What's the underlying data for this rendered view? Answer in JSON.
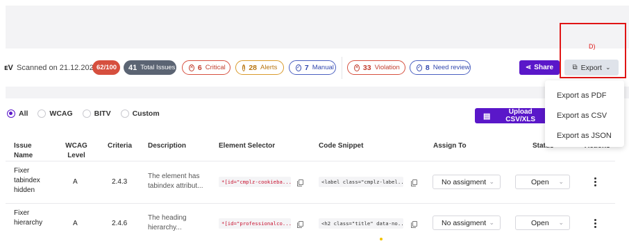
{
  "toolbar": {
    "title_fragment": "ᴇV",
    "scanned_label": "Scanned on 21.12.2025",
    "score": "62/100",
    "total_count": "41",
    "total_label": "Total Issues",
    "critical_count": "6",
    "critical_label": "Critical",
    "alerts_count": "28",
    "alerts_label": "Alerts",
    "manual_count": "7",
    "manual_label": "Manual",
    "violation_count": "33",
    "violation_label": "Violation",
    "review_count": "8",
    "review_label": "Need review",
    "share_label": "Share",
    "export_label": "Export",
    "annotation_label": "D)"
  },
  "filters": {
    "options": [
      "All",
      "WCAG",
      "BITV",
      "Custom"
    ],
    "selected": "All",
    "upload_label": "Upload CSV/XLS"
  },
  "export_menu": {
    "items": [
      "Export as PDF",
      "Export as CSV",
      "Export as JSON"
    ]
  },
  "table": {
    "headers": {
      "issue_name": [
        "Issue",
        "Name"
      ],
      "wcag_level": [
        "WCAG",
        "Level"
      ],
      "criteria": "Criteria",
      "description": "Description",
      "element_selector": "Element Selector",
      "code_snippet": "Code Snippet",
      "assign_to": "Assign To",
      "status": "Status",
      "actions": "Actions"
    },
    "rows": [
      {
        "name_lines": [
          "Fixer",
          "tabindex",
          "hidden"
        ],
        "level": "A",
        "criteria": "2.4.3",
        "description_lines": [
          "The element has",
          "tabindex attribut..."
        ],
        "selector": "*[id=\"cmplz-cookieba...",
        "snippet": "<label class=\"cmplz-label...",
        "assign": "No assigment",
        "status": "Open"
      },
      {
        "name_lines": [
          "Fixer",
          "hierarchy",
          ""
        ],
        "level": "A",
        "criteria": "2.4.6",
        "description_lines": [
          "The heading",
          "hierarchy..."
        ],
        "selector": "*[id=\"professionalco...",
        "snippet": "<h2 class=\"title\" data-no...",
        "assign": "No assigment",
        "status": "Open"
      }
    ]
  },
  "colors": {
    "brand_purple": "#5a17c9",
    "critical_red": "#d64f3e",
    "alert_orange": "#d99a2b",
    "info_blue": "#4a5fc0",
    "annotation_red": "#e01414"
  }
}
